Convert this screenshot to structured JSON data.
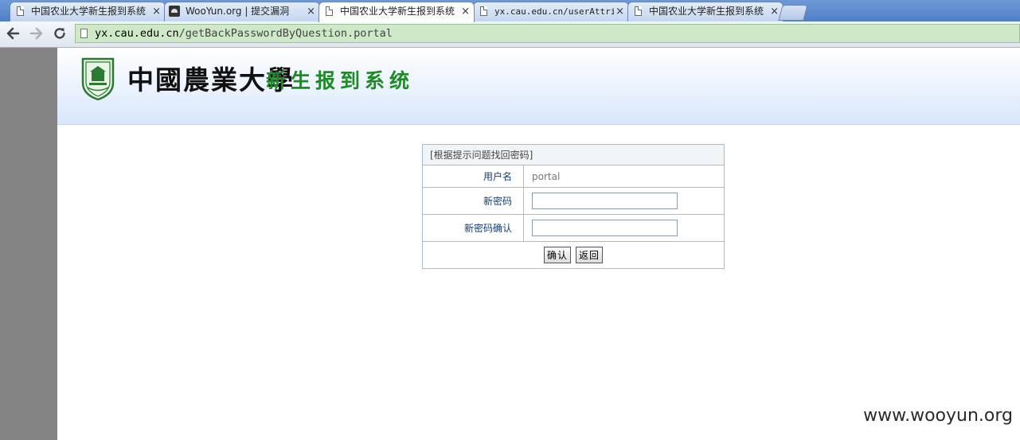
{
  "browser": {
    "tabs": [
      {
        "title": "中国农业大学新生报到系统",
        "icon": "page-icon",
        "active": false
      },
      {
        "title": "WooYun.org | 提交漏洞",
        "icon": "wooyun-favicon",
        "active": false
      },
      {
        "title": "中国农业大学新生报到系统",
        "icon": "page-icon",
        "active": true
      },
      {
        "title": "yx.cau.edu.cn/userAttri",
        "icon": "page-icon",
        "active": false
      },
      {
        "title": "中国农业大学新生报到系统",
        "icon": "page-icon",
        "active": false
      }
    ],
    "close_glyph": "×",
    "url_host": "yx.cau.edu.cn",
    "url_path": "/getBackPasswordByQuestion.portal"
  },
  "header": {
    "school_name": "中國農業大學",
    "system_name": "新生报到系统"
  },
  "form": {
    "title": "[根据提示问题找回密码]",
    "username_label": "用户名",
    "username_value": "portal",
    "new_password_label": "新密码",
    "confirm_password_label": "新密码确认",
    "confirm_button": "确认",
    "back_button": "返回"
  },
  "watermark": "www.wooyun.org",
  "colors": {
    "system_name": "#1e8a28",
    "omnibox_bg": "#cfe8c8",
    "tab_bar": "#5a88cf"
  }
}
